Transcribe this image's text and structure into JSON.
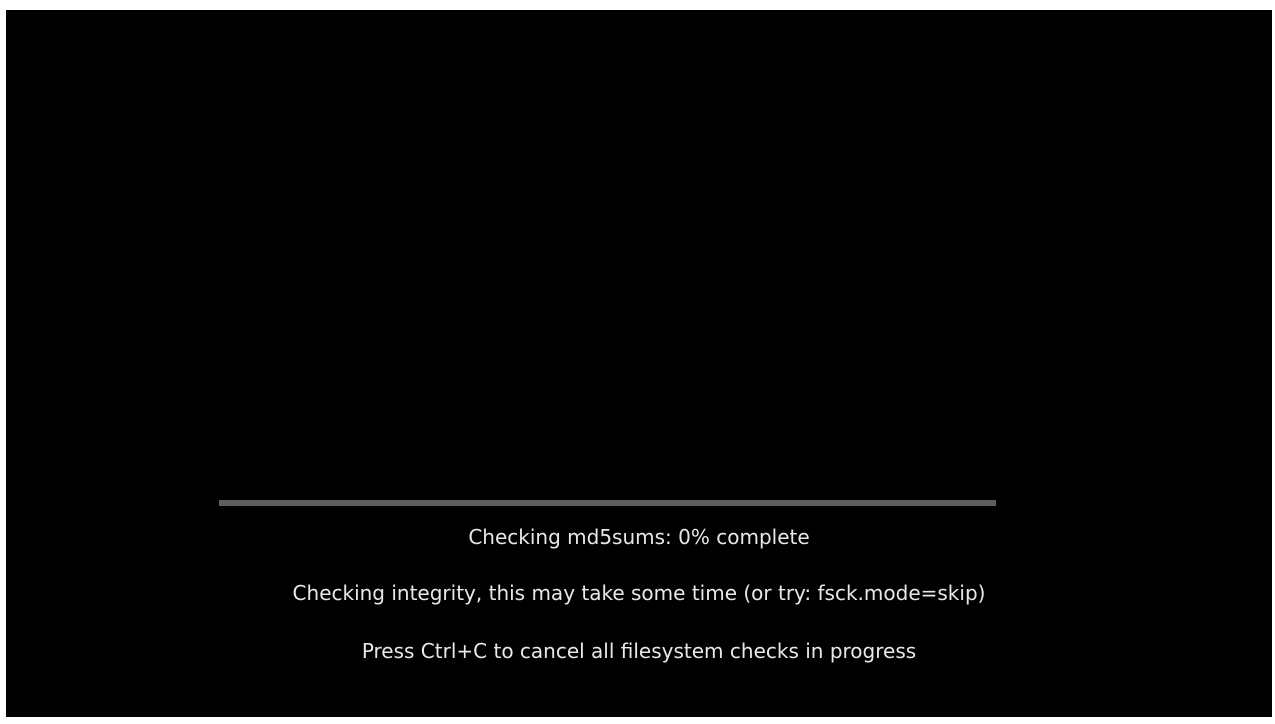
{
  "boot_check": {
    "progress_percent": 0,
    "status_text": "Checking md5sums: 0% complete",
    "integrity_text": "Checking integrity, this may take some time (or try: fsck.mode=skip)",
    "cancel_hint": "Press Ctrl+C to cancel all filesystem checks in progress"
  },
  "colors": {
    "background": "#000000",
    "text": "#e8e8e8",
    "progress_track": "#5e5e5e",
    "progress_fill": "#d9d9d9"
  }
}
